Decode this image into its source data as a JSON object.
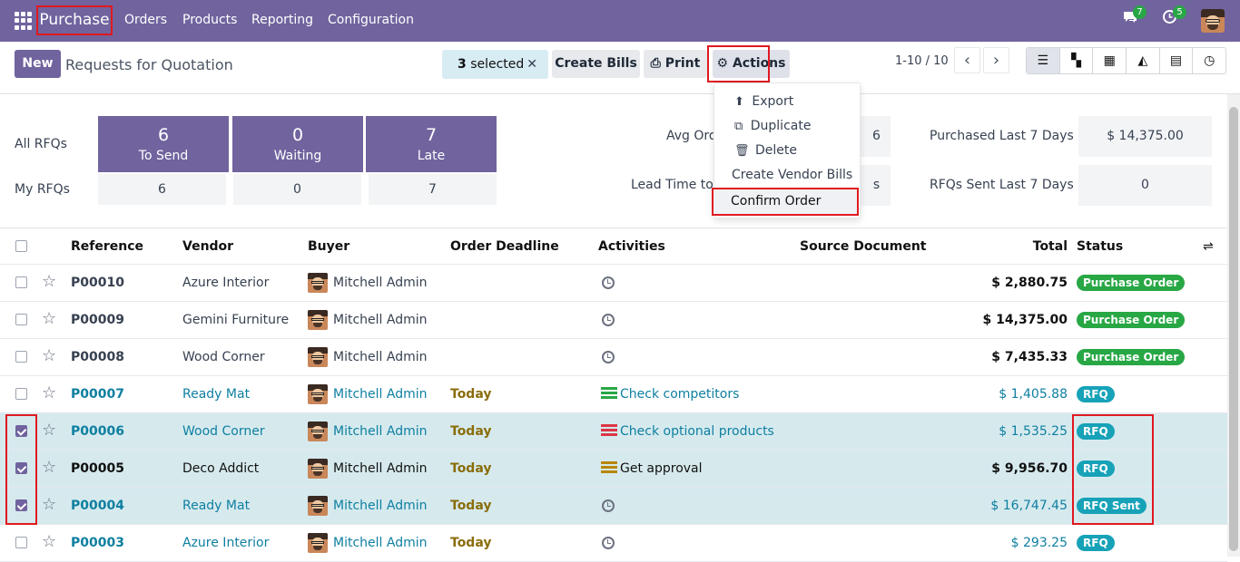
{
  "topbar": {
    "app_name": "Purchase",
    "menus": [
      "Orders",
      "Products",
      "Reporting",
      "Configuration"
    ],
    "messages_count": "7",
    "activities_count": "5"
  },
  "control": {
    "new_label": "New",
    "title": "Requests for Quotation",
    "selected_count": "3",
    "selected_label": "selected",
    "create_bills": "Create Bills",
    "print": "Print",
    "actions": "Actions",
    "pager": "1-10 / 10"
  },
  "actions_menu": [
    "Export",
    "Duplicate",
    "Delete",
    "Create Vendor Bills",
    "Confirm Order"
  ],
  "dashboard": {
    "all_rfqs": "All RFQs",
    "my_rfqs": "My RFQs",
    "tiles": [
      {
        "count": "6",
        "label": "To Send",
        "mine": "6"
      },
      {
        "count": "0",
        "label": "Waiting",
        "mine": "0"
      },
      {
        "count": "7",
        "label": "Late",
        "mine": "7"
      }
    ],
    "avg_order_label": "Avg Ord",
    "avg_order_value": "6",
    "lead_time_label": "Lead Time to P",
    "lead_time_value": "s",
    "purchased_label": "Purchased Last 7 Days",
    "purchased_value": "$ 14,375.00",
    "rfqs_sent_label": "RFQs Sent Last 7 Days",
    "rfqs_sent_value": "0"
  },
  "table": {
    "headers": {
      "reference": "Reference",
      "vendor": "Vendor",
      "buyer": "Buyer",
      "deadline": "Order Deadline",
      "activities": "Activities",
      "source": "Source Document",
      "total": "Total",
      "status": "Status"
    },
    "rows": [
      {
        "ref": "P00010",
        "vendor": "Azure Interior",
        "buyer": "Mitchell Admin",
        "deadline": "",
        "activity": "",
        "total": "$ 2,880.75",
        "status": "Purchase Order"
      },
      {
        "ref": "P00009",
        "vendor": "Gemini Furniture",
        "buyer": "Mitchell Admin",
        "deadline": "",
        "activity": "",
        "total": "$ 14,375.00",
        "status": "Purchase Order"
      },
      {
        "ref": "P00008",
        "vendor": "Wood Corner",
        "buyer": "Mitchell Admin",
        "deadline": "",
        "activity": "",
        "total": "$ 7,435.33",
        "status": "Purchase Order"
      },
      {
        "ref": "P00007",
        "vendor": "Ready Mat",
        "buyer": "Mitchell Admin",
        "deadline": "Today",
        "activity": "Check competitors",
        "total": "$ 1,405.88",
        "status": "RFQ"
      },
      {
        "ref": "P00006",
        "vendor": "Wood Corner",
        "buyer": "Mitchell Admin",
        "deadline": "Today",
        "activity": "Check optional products",
        "total": "$ 1,535.25",
        "status": "RFQ"
      },
      {
        "ref": "P00005",
        "vendor": "Deco Addict",
        "buyer": "Mitchell Admin",
        "deadline": "Today",
        "activity": "Get approval",
        "total": "$ 9,956.70",
        "status": "RFQ"
      },
      {
        "ref": "P00004",
        "vendor": "Ready Mat",
        "buyer": "Mitchell Admin",
        "deadline": "Today",
        "activity": "",
        "total": "$ 16,747.45",
        "status": "RFQ Sent"
      },
      {
        "ref": "P00003",
        "vendor": "Azure Interior",
        "buyer": "Mitchell Admin",
        "deadline": "Today",
        "activity": "",
        "total": "$ 293.25",
        "status": "RFQ"
      }
    ]
  },
  "colors": {
    "brand": "#71639e",
    "highlight": "#e0191f",
    "po": "#28a745",
    "rfq": "#17a2b8"
  }
}
